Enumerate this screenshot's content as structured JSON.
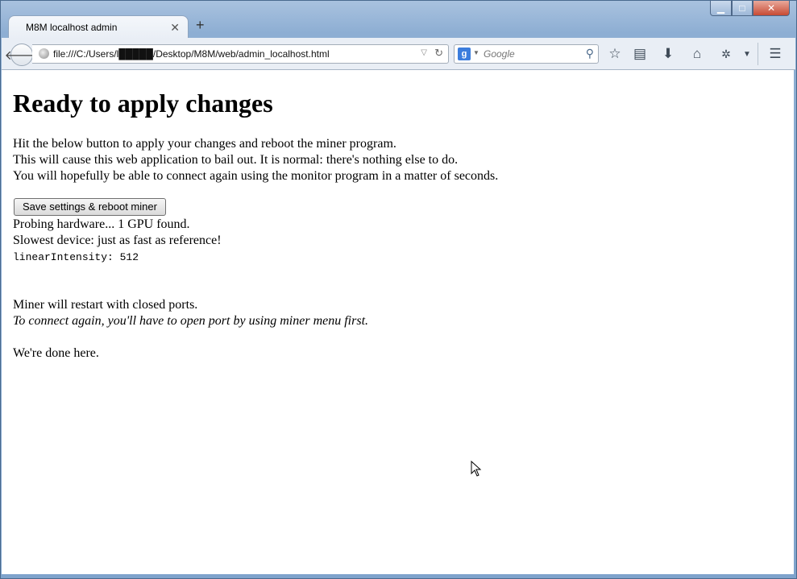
{
  "window": {
    "controls": {
      "minimize": "▁",
      "maximize": "□",
      "close": "✕"
    }
  },
  "tab": {
    "title": "M8M localhost admin",
    "close": "✕",
    "new_tab": "+"
  },
  "navbar": {
    "url": "file:///C:/Users/l█████/Desktop/M8M/web/admin_localhost.html",
    "search_placeholder": "Google",
    "icons": [
      "back-arrow-icon",
      "globe-icon",
      "reload-icon",
      "google-icon",
      "search-icon",
      "bookmark-star-icon",
      "reading-list-icon",
      "download-icon",
      "home-icon",
      "addon-icon",
      "dropdown-icon",
      "menu-icon"
    ]
  },
  "page": {
    "heading": "Ready to apply changes",
    "intro": [
      "Hit the below button to apply your changes and reboot the miner program.",
      "This will cause this web application to bail out. It is normal: there's nothing else to do.",
      "You will hopefully be able to connect again using the monitor program in a matter of seconds."
    ],
    "button_label": "Save settings & reboot miner",
    "log": {
      "probing": "Probing hardware... 1 GPU found.",
      "slowest": "Slowest device: just as fast as reference!",
      "intensity": "linearIntensity: 512",
      "restart": "Miner will restart with closed ports.",
      "connect_hint": "To connect again, you'll have to open port by using miner menu first.",
      "done": "We're done here."
    }
  }
}
